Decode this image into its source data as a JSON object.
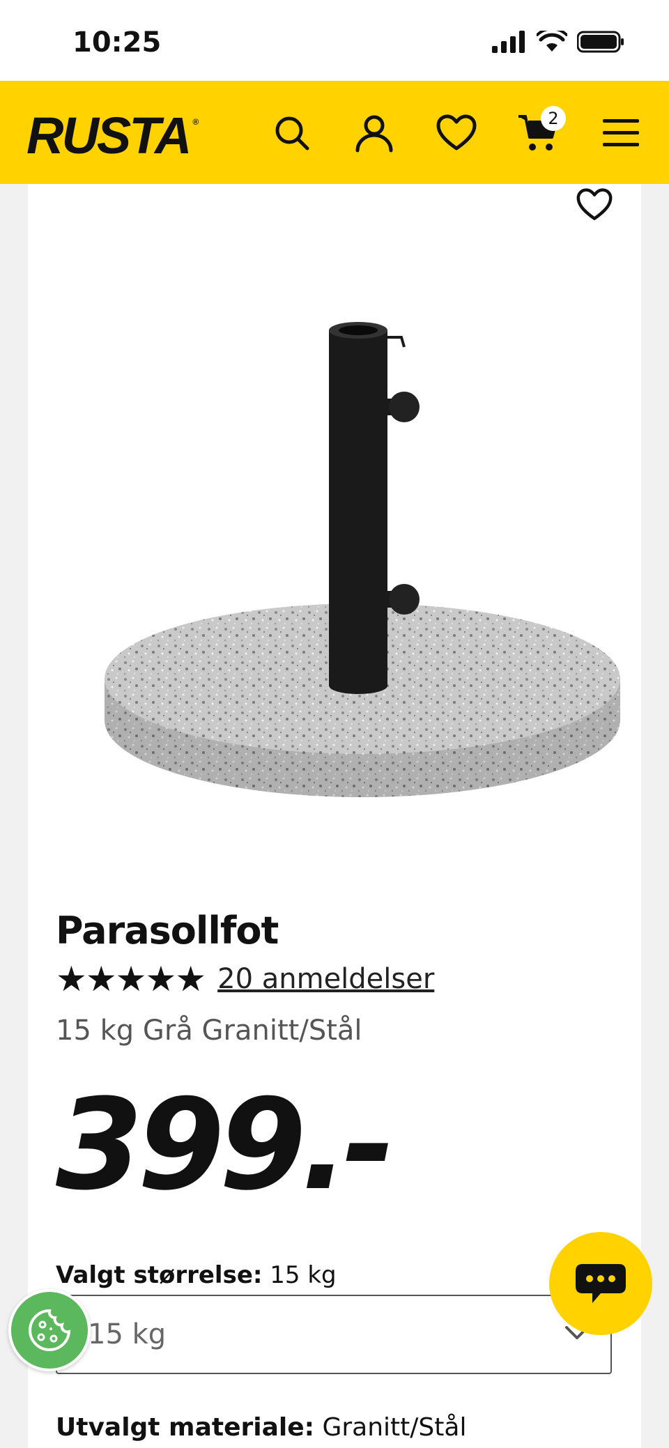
{
  "status_bar": {
    "time": "10:25"
  },
  "header": {
    "logo": "RUSTA",
    "logo_mark": "®",
    "cart_count": "2",
    "icons": [
      "search-icon",
      "user-icon",
      "heart-icon",
      "cart-icon",
      "menu-icon"
    ]
  },
  "product": {
    "title": "Parasollfot",
    "stars": "★★★★★",
    "rating_value": 5,
    "reviews": "20 anmeldelser",
    "variant": "15 kg Grå Granitt/Stål",
    "price": "399.-",
    "size_label": "Valgt størrelse:",
    "size_value": "15 kg",
    "size_select_value": "15 kg",
    "material_label": "Utvalgt materiale:",
    "material_value": "Granitt/Stål"
  },
  "colors": {
    "brand_yellow": "#ffd200",
    "cookie_green": "#5cb85c"
  }
}
